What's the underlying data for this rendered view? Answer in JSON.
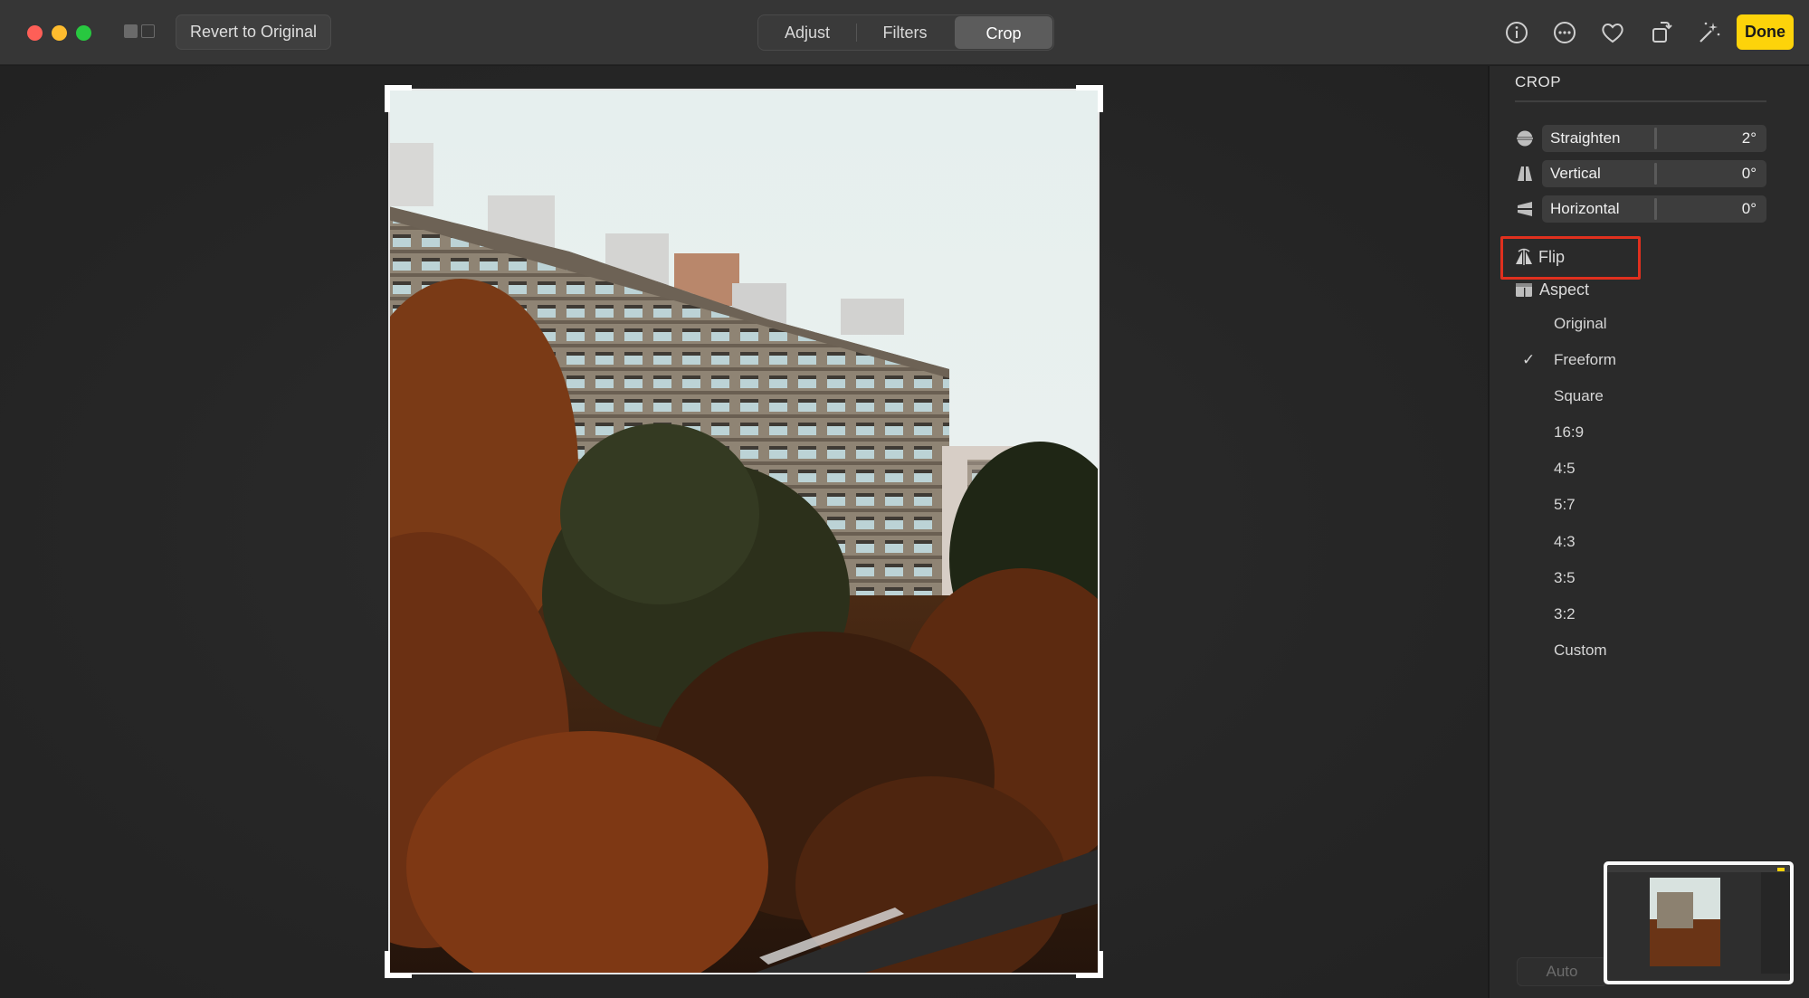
{
  "toolbar": {
    "revert_label": "Revert to Original",
    "tabs": [
      {
        "label": "Adjust",
        "active": false
      },
      {
        "label": "Filters",
        "active": false
      },
      {
        "label": "Crop",
        "active": true
      }
    ],
    "icons": [
      "info-icon",
      "more-icon",
      "heart-icon",
      "rotate-icon",
      "magic-wand-icon"
    ],
    "done_label": "Done",
    "done_color": "#fdd30a"
  },
  "panel": {
    "title": "CROP",
    "sliders": [
      {
        "name": "Straighten",
        "value": "2°",
        "icon": "straighten-icon"
      },
      {
        "name": "Vertical",
        "value": "0°",
        "icon": "vertical-perspective-icon"
      },
      {
        "name": "Horizontal",
        "value": "0°",
        "icon": "horizontal-perspective-icon"
      }
    ],
    "flip_label": "Flip",
    "aspect_label": "Aspect",
    "aspect_options": [
      "Original",
      "Freeform",
      "Square",
      "16:9",
      "4:5",
      "5:7",
      "4:3",
      "3:5",
      "3:2",
      "Custom"
    ],
    "selected_aspect": "Freeform",
    "check_mark": "✓",
    "auto_label": "Auto",
    "highlight_color": "#e0301e"
  }
}
